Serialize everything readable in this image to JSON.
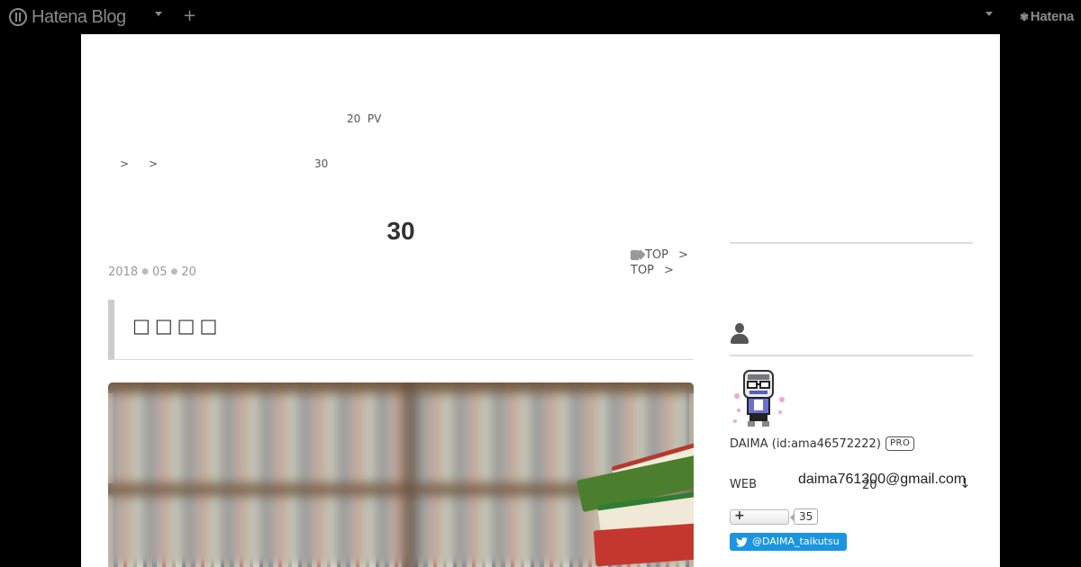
{
  "topbar": {
    "logo_text": "Hatena Blog",
    "add_label": "+",
    "brand": "Hatena"
  },
  "header": {
    "stats": "20  PV"
  },
  "breadcrumb": {
    "sep1": ">",
    "sep2": ">",
    "current": "30"
  },
  "article": {
    "title": "30",
    "date": {
      "year": "2018",
      "month": "05",
      "day": "20"
    },
    "categories": [
      {
        "label": "TOP",
        "arrow": ">"
      },
      {
        "label": "TOP",
        "arrow": ">"
      }
    ],
    "heading": "□□□□",
    "hero_icon": "bookshelf-with-stacked-books"
  },
  "sidebar": {
    "profile_icon": "user-icon",
    "name": "DAIMA (id:ama46572222)",
    "badge": "PRO",
    "web_label": "WEB",
    "web_num": "20",
    "email": "daima761300@gmail.com",
    "arrow": "↓",
    "follow_plus": "+",
    "follow_count": "35",
    "twitter_handle": "@DAIMA_taikutsu"
  },
  "colors": {
    "background": "#000000",
    "page": "#ffffff",
    "twitter": "#1b95e0",
    "heading_border": "#cccccc"
  }
}
